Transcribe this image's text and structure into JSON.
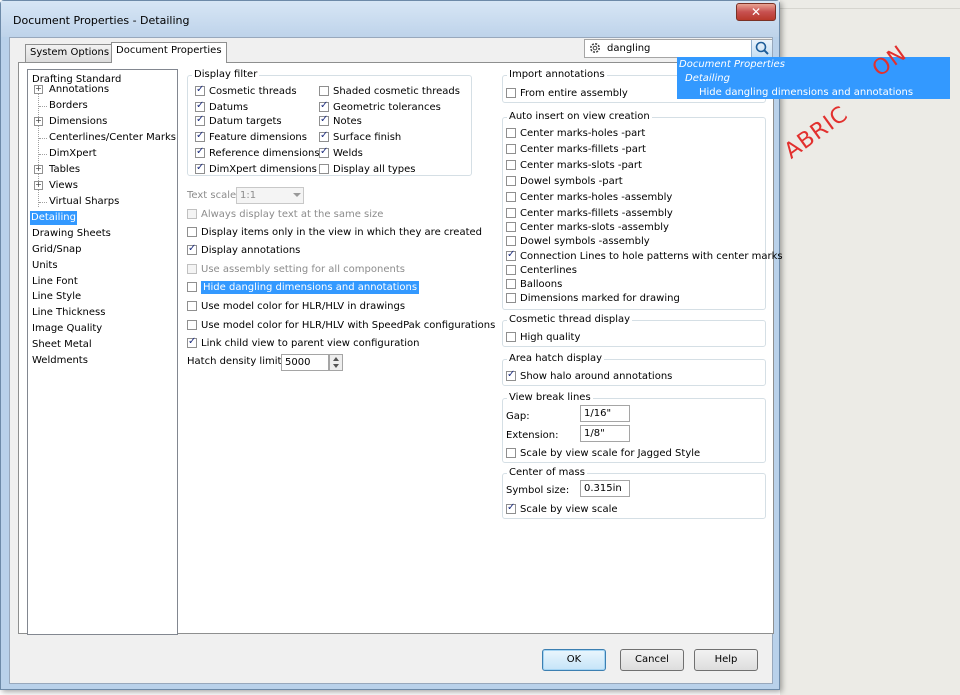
{
  "window": {
    "title": "Document Properties - Detailing",
    "close_label": "✕"
  },
  "tabs": [
    {
      "label": "System Options"
    },
    {
      "label": "Document Properties"
    }
  ],
  "search": {
    "value": "dangling"
  },
  "search_popup": {
    "line1": "Document Properties",
    "line2": "Detailing",
    "line3": "Hide dangling dimensions and annotations"
  },
  "tree": {
    "items": [
      {
        "label": "Drafting Standard"
      },
      {
        "label": "Annotations"
      },
      {
        "label": "Borders"
      },
      {
        "label": "Dimensions"
      },
      {
        "label": "Centerlines/Center Marks"
      },
      {
        "label": "DimXpert"
      },
      {
        "label": "Tables"
      },
      {
        "label": "Views"
      },
      {
        "label": "Virtual Sharps"
      },
      {
        "label": "Detailing"
      },
      {
        "label": "Drawing Sheets"
      },
      {
        "label": "Grid/Snap"
      },
      {
        "label": "Units"
      },
      {
        "label": "Line Font"
      },
      {
        "label": "Line Style"
      },
      {
        "label": "Line Thickness"
      },
      {
        "label": "Image Quality"
      },
      {
        "label": "Sheet Metal"
      },
      {
        "label": "Weldments"
      }
    ]
  },
  "display_filter": {
    "title": "Display filter",
    "items": [
      {
        "label": "Cosmetic threads",
        "checked": true
      },
      {
        "label": "Datums",
        "checked": true
      },
      {
        "label": "Datum targets",
        "checked": true
      },
      {
        "label": "Feature dimensions",
        "checked": true
      },
      {
        "label": "Reference dimensions",
        "checked": true
      },
      {
        "label": "DimXpert dimensions",
        "checked": true
      },
      {
        "label": "Shaded cosmetic threads",
        "checked": false
      },
      {
        "label": "Geometric tolerances",
        "checked": true
      },
      {
        "label": "Notes",
        "checked": true
      },
      {
        "label": "Surface finish",
        "checked": true
      },
      {
        "label": "Welds",
        "checked": true
      },
      {
        "label": "Display all types",
        "checked": false
      }
    ]
  },
  "text_scale": {
    "label": "Text scale:",
    "value": "1:1"
  },
  "left_options": [
    {
      "label": "Always display text at the same size",
      "checked": false
    },
    {
      "label": "Display items only in the view in which they are created",
      "checked": false
    },
    {
      "label": "Display annotations",
      "checked": true
    },
    {
      "label": "Use assembly setting for all components",
      "checked": false
    },
    {
      "label": "Hide dangling dimensions and annotations",
      "checked": false
    },
    {
      "label": "Use model color for HLR/HLV in drawings",
      "checked": false
    },
    {
      "label": "Use model color for HLR/HLV with SpeedPak configurations",
      "checked": false
    },
    {
      "label": "Link child view to parent view configuration",
      "checked": true
    }
  ],
  "hatch_density": {
    "label": "Hatch density limit:",
    "value": "5000"
  },
  "import_annotations": {
    "title": "Import annotations",
    "items": [
      {
        "label": "From entire assembly",
        "checked": false
      }
    ]
  },
  "auto_insert": {
    "title": "Auto insert on view creation",
    "items": [
      {
        "label": "Center marks-holes -part",
        "checked": false
      },
      {
        "label": "Center marks-fillets -part",
        "checked": false
      },
      {
        "label": "Center marks-slots  -part",
        "checked": false
      },
      {
        "label": "Dowel symbols -part",
        "checked": false
      },
      {
        "label": "Center marks-holes -assembly",
        "checked": false
      },
      {
        "label": "Center marks-fillets -assembly",
        "checked": false
      },
      {
        "label": "Center marks-slots  -assembly",
        "checked": false
      },
      {
        "label": "Dowel symbols -assembly",
        "checked": false
      },
      {
        "label": "Connection Lines to hole patterns with center marks",
        "checked": true
      },
      {
        "label": "Centerlines",
        "checked": false
      },
      {
        "label": "Balloons",
        "checked": false
      },
      {
        "label": "Dimensions marked for drawing",
        "checked": false
      }
    ]
  },
  "cosmetic_thread": {
    "title": "Cosmetic thread display",
    "items": [
      {
        "label": "High quality",
        "checked": false
      }
    ]
  },
  "area_hatch": {
    "title": "Area hatch display",
    "items": [
      {
        "label": "Show halo around annotations",
        "checked": true
      }
    ]
  },
  "view_break": {
    "title": "View break lines",
    "gap_label": "Gap:",
    "gap_value": "1/16\"",
    "ext_label": "Extension:",
    "ext_value": "1/8\"",
    "items": [
      {
        "label": "Scale by view scale for Jagged Style",
        "checked": false
      }
    ]
  },
  "center_mass": {
    "title": "Center of mass",
    "symbol_label": "Symbol size:",
    "symbol_value": "0.315in",
    "items": [
      {
        "label": "Scale by view scale",
        "checked": true
      }
    ]
  },
  "buttons": {
    "ok": "OK",
    "cancel": "Cancel",
    "help": "Help"
  },
  "watermark": {
    "top": "ABRIC",
    "top2": "ON"
  },
  "colors": {
    "selection": "#3399ff",
    "watermark": "#e2302e",
    "window_frame": "#b9d1ea"
  }
}
